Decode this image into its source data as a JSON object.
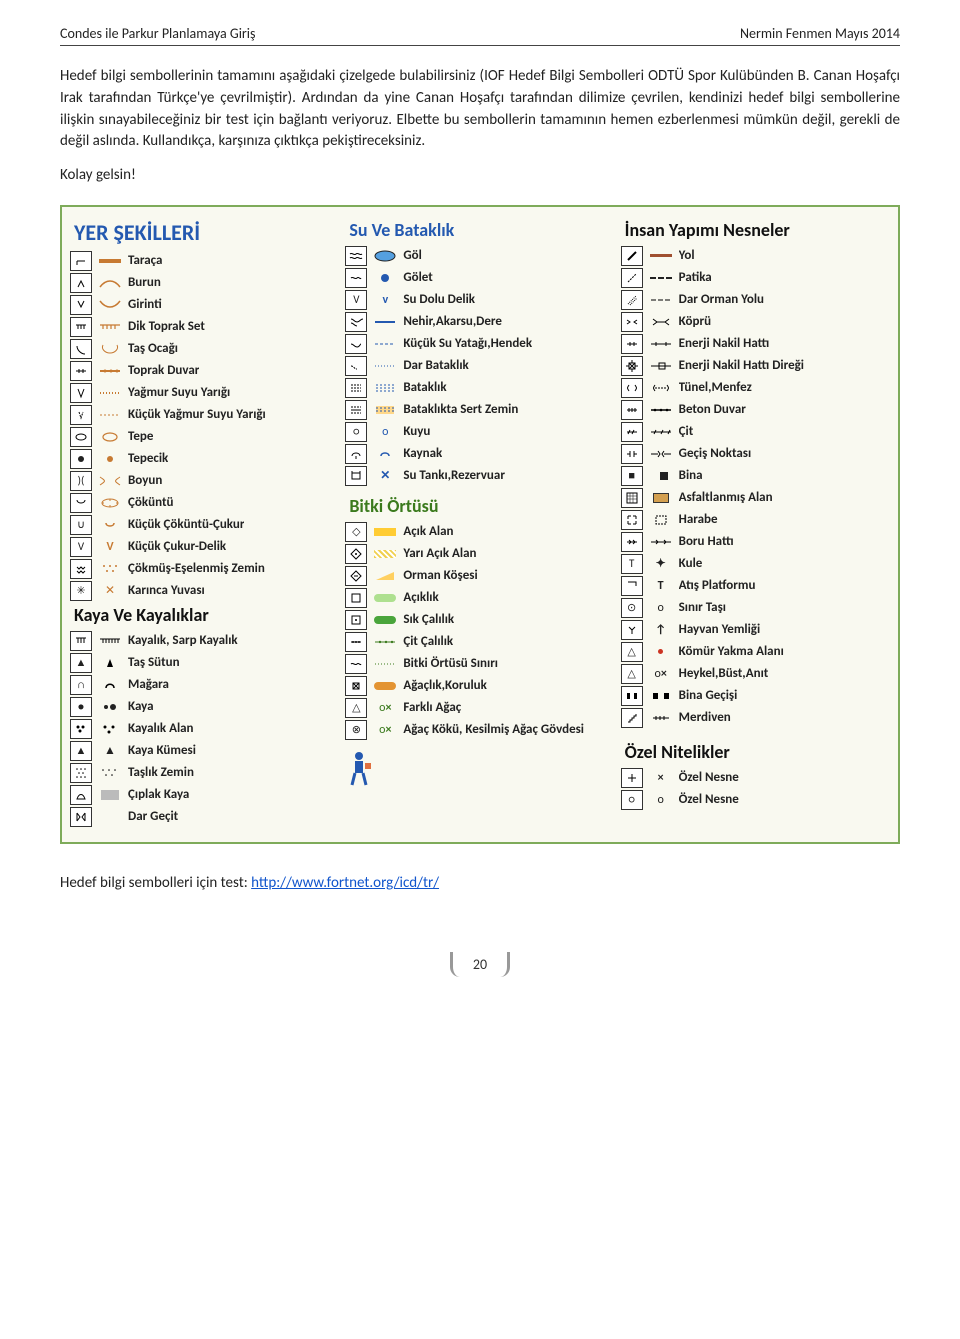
{
  "header": {
    "left": "Condes ile Parkur Planlamaya Giriş",
    "right": "Nermin Fenmen Mayıs 2014"
  },
  "paragraphs": {
    "p1": "Hedef bilgi sembollerinin tamamını aşağıdaki çizelgede bulabilirsiniz (IOF Hedef Bilgi Sembolleri ODTÜ Spor Kulübünden B. Canan Hoşafçı Irak tarafından Türkçe'ye çevrilmiştir). Ardından da yine Canan Hoşafçı tarafından dilimize çevrilen, kendinizi hedef bilgi sembollerine ilişkin sınayabileceğiniz bir test için bağlantı veriyoruz. Elbette bu sembollerin tamamının hemen ezberlenmesi mümkün değil, gerekli de değil aslında. Kullandıkça, karşınıza çıktıkça pekiştireceksiniz.",
    "p2": "Kolay gelsin!"
  },
  "sections": {
    "landforms": {
      "title": "YER ŞEKİLLERİ",
      "items": [
        {
          "label": "Taraça"
        },
        {
          "label": "Burun"
        },
        {
          "label": "Girinti"
        },
        {
          "label": "Dik Toprak Set"
        },
        {
          "label": "Taş Ocağı"
        },
        {
          "label": "Toprak Duvar"
        },
        {
          "label": "Yağmur Suyu Yarığı"
        },
        {
          "label": "Küçük Yağmur Suyu Yarığı"
        },
        {
          "label": "Tepe"
        },
        {
          "label": "Tepecik"
        },
        {
          "label": "Boyun"
        },
        {
          "label": "Çöküntü"
        },
        {
          "label": "Küçük Çöküntü-Çukur"
        },
        {
          "label": "Küçük Çukur-Delik"
        },
        {
          "label": "Çökmüş-Eşelenmiş Zemin"
        },
        {
          "label": "Karınca Yuvası"
        }
      ]
    },
    "rocks": {
      "title": "Kaya Ve Kayalıklar",
      "items": [
        {
          "label": "Kayalık, Sarp Kayalık"
        },
        {
          "label": "Taş Sütun"
        },
        {
          "label": "Mağara"
        },
        {
          "label": "Kaya"
        },
        {
          "label": "Kayalık Alan"
        },
        {
          "label": "Kaya Kümesi"
        },
        {
          "label": "Taşlık Zemin"
        },
        {
          "label": "Çıplak Kaya"
        },
        {
          "label": "Dar Geçit"
        }
      ]
    },
    "water": {
      "title": "Su Ve Bataklık",
      "items": [
        {
          "label": "Göl"
        },
        {
          "label": "Gölet"
        },
        {
          "label": "Su Dolu Delik"
        },
        {
          "label": "Nehir,Akarsu,Dere"
        },
        {
          "label": "Küçük Su Yatağı,Hendek"
        },
        {
          "label": "Dar Bataklık"
        },
        {
          "label": "Bataklık"
        },
        {
          "label": "Bataklıkta Sert Zemin"
        },
        {
          "label": "Kuyu"
        },
        {
          "label": "Kaynak"
        },
        {
          "label": "Su Tankı,Rezervuar"
        }
      ]
    },
    "vegetation": {
      "title": "Bitki Örtüsü",
      "items": [
        {
          "label": "Açık Alan"
        },
        {
          "label": "Yarı Açık Alan"
        },
        {
          "label": "Orman Köşesi"
        },
        {
          "label": "Açıklık"
        },
        {
          "label": "Sık Çalılık"
        },
        {
          "label": "Çit Çalılık"
        },
        {
          "label": "Bitki Örtüsü Sınırı"
        },
        {
          "label": "Ağaçlık,Koruluk"
        },
        {
          "label": "Farklı Ağaç"
        },
        {
          "label": "Ağaç Kökü, Kesilmiş Ağaç Gövdesi"
        }
      ]
    },
    "manmade": {
      "title": "İnsan Yapımı Nesneler",
      "items": [
        {
          "label": "Yol"
        },
        {
          "label": "Patika"
        },
        {
          "label": "Dar Orman Yolu"
        },
        {
          "label": "Köprü"
        },
        {
          "label": "Enerji Nakil Hattı"
        },
        {
          "label": "Enerji Nakil Hattı Direği"
        },
        {
          "label": "Tünel,Menfez"
        },
        {
          "label": "Beton Duvar"
        },
        {
          "label": "Çit"
        },
        {
          "label": "Geçiş Noktası"
        },
        {
          "label": "Bina"
        },
        {
          "label": "Asfaltlanmış Alan"
        },
        {
          "label": "Harabe"
        },
        {
          "label": "Boru Hattı"
        },
        {
          "label": "Kule"
        },
        {
          "label": "Atış Platformu"
        },
        {
          "label": "Sınır Taşı"
        },
        {
          "label": "Hayvan Yemliği"
        },
        {
          "label": "Kömür Yakma Alanı"
        },
        {
          "label": "Heykel,Büst,Anıt"
        },
        {
          "label": "Bina Geçişi"
        },
        {
          "label": "Merdiven"
        }
      ]
    },
    "special": {
      "title": "Özel Nitelikler",
      "items": [
        {
          "label": "Özel Nesne"
        },
        {
          "label": "Özel Nesne"
        }
      ]
    }
  },
  "footer": {
    "text_before": "Hedef bilgi sembolleri için test: ",
    "link_text": "http://www.fortnet.org/icd/tr/",
    "link_href": "http://www.fortnet.org/icd/tr/"
  },
  "page_number": "20"
}
